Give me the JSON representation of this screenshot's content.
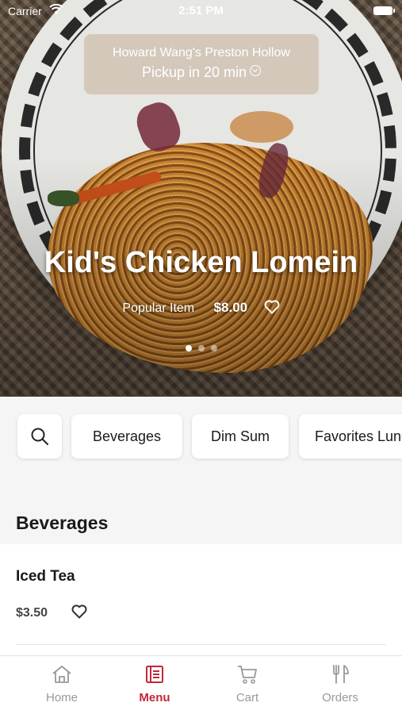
{
  "status_bar": {
    "carrier": "Carrier",
    "time": "2:51 PM"
  },
  "store": {
    "name": "Howard Wang's Preston Hollow",
    "pickup": "Pickup in 20 min"
  },
  "featured": {
    "title": "Kid's Chicken Lomein",
    "tag": "Popular Item",
    "price": "$8.00",
    "slide_index": 1,
    "slide_count": 3
  },
  "categories": [
    {
      "label": "Beverages"
    },
    {
      "label": "Dim Sum"
    },
    {
      "label": "Favorites Lunch"
    }
  ],
  "section": {
    "title": "Beverages"
  },
  "items": [
    {
      "name": "Iced Tea",
      "price": "$3.50"
    }
  ],
  "tabs": [
    {
      "label": "Home",
      "icon": "home-icon"
    },
    {
      "label": "Menu",
      "icon": "menu-icon"
    },
    {
      "label": "Cart",
      "icon": "cart-icon"
    },
    {
      "label": "Orders",
      "icon": "fork-knife-icon"
    }
  ],
  "colors": {
    "accent": "#c0283a"
  }
}
